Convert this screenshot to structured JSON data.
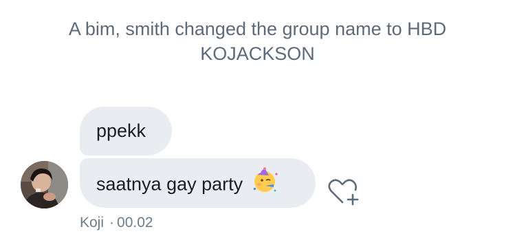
{
  "system_message": {
    "line1": "A bim, smith changed the group name to HBD",
    "line2": "KOJACKSON"
  },
  "messages": [
    {
      "text": "ppekk"
    },
    {
      "text": "saatnya gay party",
      "emoji": "partying-face-emoji"
    }
  ],
  "sender": {
    "name": "Koji",
    "separator": "·",
    "time": "00.02",
    "avatar": "profile-photo"
  },
  "icons": {
    "react": "heart-plus-icon"
  },
  "colors": {
    "bubble": "#e9ecf1",
    "system_text": "#5d6a7a",
    "meta_text": "#6e7b8b",
    "message_text": "#1c1e21"
  }
}
